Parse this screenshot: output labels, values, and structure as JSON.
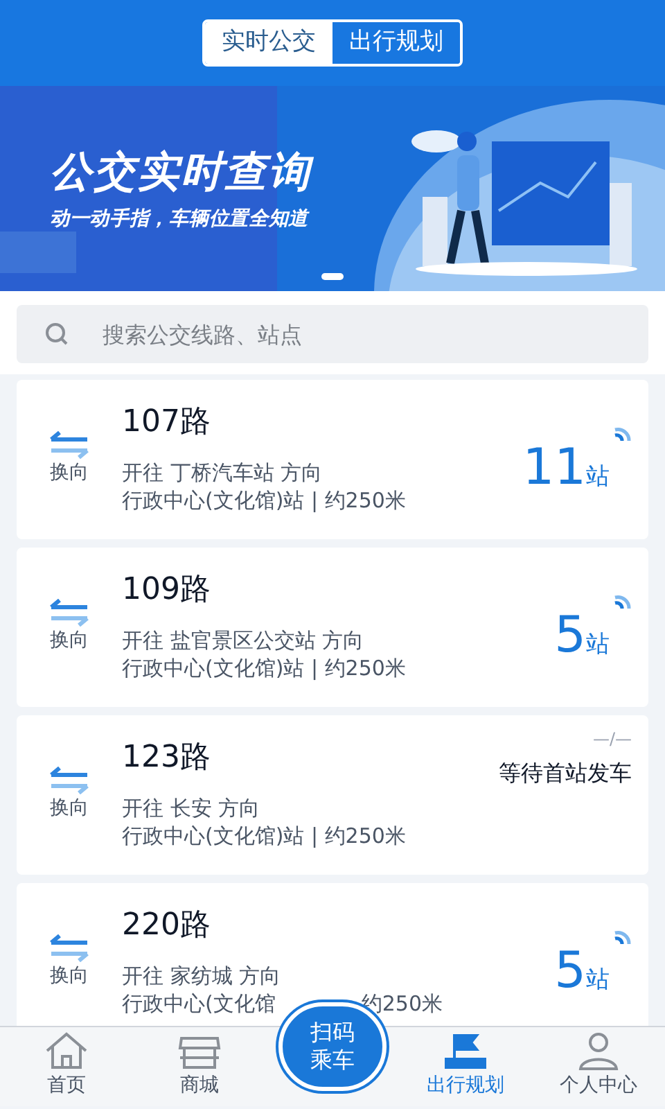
{
  "tabs": [
    {
      "label": "实时公交",
      "selected": true
    },
    {
      "label": "出行规划",
      "selected": false
    }
  ],
  "banner": {
    "title": "公交实时查询",
    "subtitle": "动一动手指，车辆位置全知道",
    "pages": [
      {
        "selected": true
      }
    ]
  },
  "search": {
    "placeholder": "搜索公交线路、站点"
  },
  "routes": [
    {
      "swap_label": "换向",
      "name": "107路",
      "direction": "开往 丁桥汽车站 方向",
      "stop_parts": [
        "行政中心(文化馆)站 | 约250米"
      ],
      "arrival": {
        "kind": "stops",
        "count": "11",
        "unit": "站"
      }
    },
    {
      "swap_label": "换向",
      "name": "109路",
      "direction": "开往 盐官景区公交站 方向",
      "stop_parts": [
        "行政中心(文化馆)站 | 约250米"
      ],
      "arrival": {
        "kind": "stops",
        "count": "5",
        "unit": "站"
      }
    },
    {
      "swap_label": "换向",
      "name": "123路",
      "direction": "开往 长安 方向",
      "stop_parts": [
        "行政中心(文化馆)站 | 约250米"
      ],
      "arrival": {
        "kind": "waiting",
        "mark": "—/—",
        "text": "等待首站发车"
      }
    },
    {
      "swap_label": "换向",
      "name": "220路",
      "direction": "开往 家纺城 方向",
      "stop_parts": [
        "行政中心(文化馆",
        "约250米"
      ],
      "arrival": {
        "kind": "stops",
        "count": "5",
        "unit": "站"
      }
    }
  ],
  "nav": [
    {
      "kind": "home",
      "label": "首页",
      "selected": false
    },
    {
      "kind": "shop",
      "label": "商城",
      "selected": false
    },
    {
      "kind": "scan",
      "label": "扫码乘车",
      "selected": false
    },
    {
      "kind": "plan",
      "label": "出行规划",
      "selected": true
    },
    {
      "kind": "user",
      "label": "个人中心",
      "selected": false
    }
  ]
}
